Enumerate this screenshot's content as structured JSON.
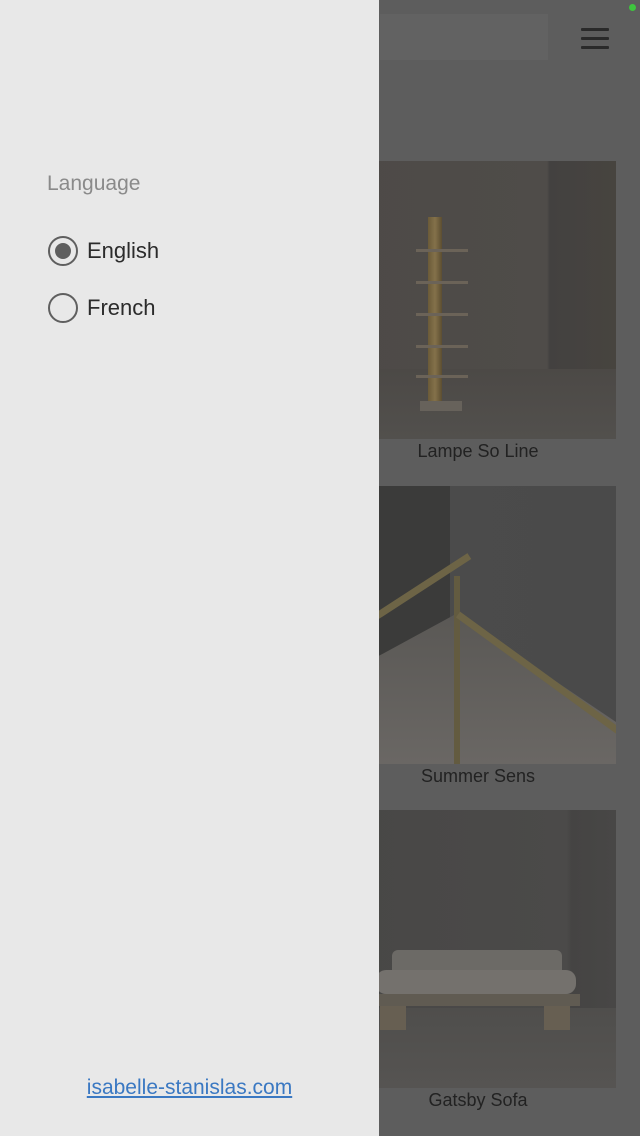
{
  "header": {
    "menu_icon": "hamburger-menu-icon"
  },
  "products": [
    {
      "name": "Lampe So Line"
    },
    {
      "name": "Summer Sens"
    },
    {
      "name": "Gatsby Sofa"
    }
  ],
  "drawer": {
    "section_label": "Language",
    "options": [
      {
        "label": "English",
        "selected": true
      },
      {
        "label": "French",
        "selected": false
      }
    ],
    "footer_link": "isabelle-stanislas.com"
  },
  "colors": {
    "drawer_background": "#e8e8e8",
    "link": "#3a78c2",
    "radio": "#5f5f5f",
    "status_indicator": "#3ec43e"
  }
}
